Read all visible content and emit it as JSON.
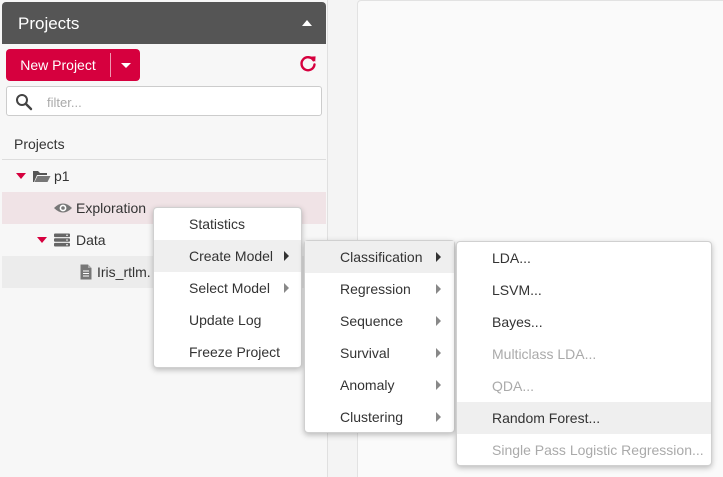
{
  "sidebar": {
    "header_title": "Projects",
    "new_project_label": "New Project",
    "filter_placeholder": "filter...",
    "tree_heading": "Projects",
    "tree": {
      "project": "p1",
      "exploration": "Exploration",
      "data": "Data",
      "file": "Iris_rtlm."
    }
  },
  "context_menu": {
    "items": [
      {
        "label": "Statistics"
      },
      {
        "label": "Create Model"
      },
      {
        "label": "Select Model"
      },
      {
        "label": "Update Log"
      },
      {
        "label": "Freeze Project"
      }
    ]
  },
  "model_menu": {
    "items": [
      {
        "label": "Classification"
      },
      {
        "label": "Regression"
      },
      {
        "label": "Sequence"
      },
      {
        "label": "Survival"
      },
      {
        "label": "Anomaly"
      },
      {
        "label": "Clustering"
      }
    ]
  },
  "classification_menu": {
    "items": [
      {
        "label": "LDA..."
      },
      {
        "label": "LSVM..."
      },
      {
        "label": "Bayes..."
      },
      {
        "label": "Multiclass LDA..."
      },
      {
        "label": "QDA..."
      },
      {
        "label": "Random Forest..."
      },
      {
        "label": "Single Pass Logistic Regression..."
      }
    ]
  },
  "colors": {
    "accent": "#d6003e",
    "header_bg": "#555555",
    "selected_row": "#f0e3e6"
  },
  "icons": {
    "collapse": "chevron-up-icon",
    "dropdown": "caret-down-icon",
    "refresh": "refresh-icon",
    "search": "search-icon",
    "folder": "folder-open-icon",
    "eye": "eye-icon",
    "database": "database-icon",
    "file": "file-icon"
  }
}
